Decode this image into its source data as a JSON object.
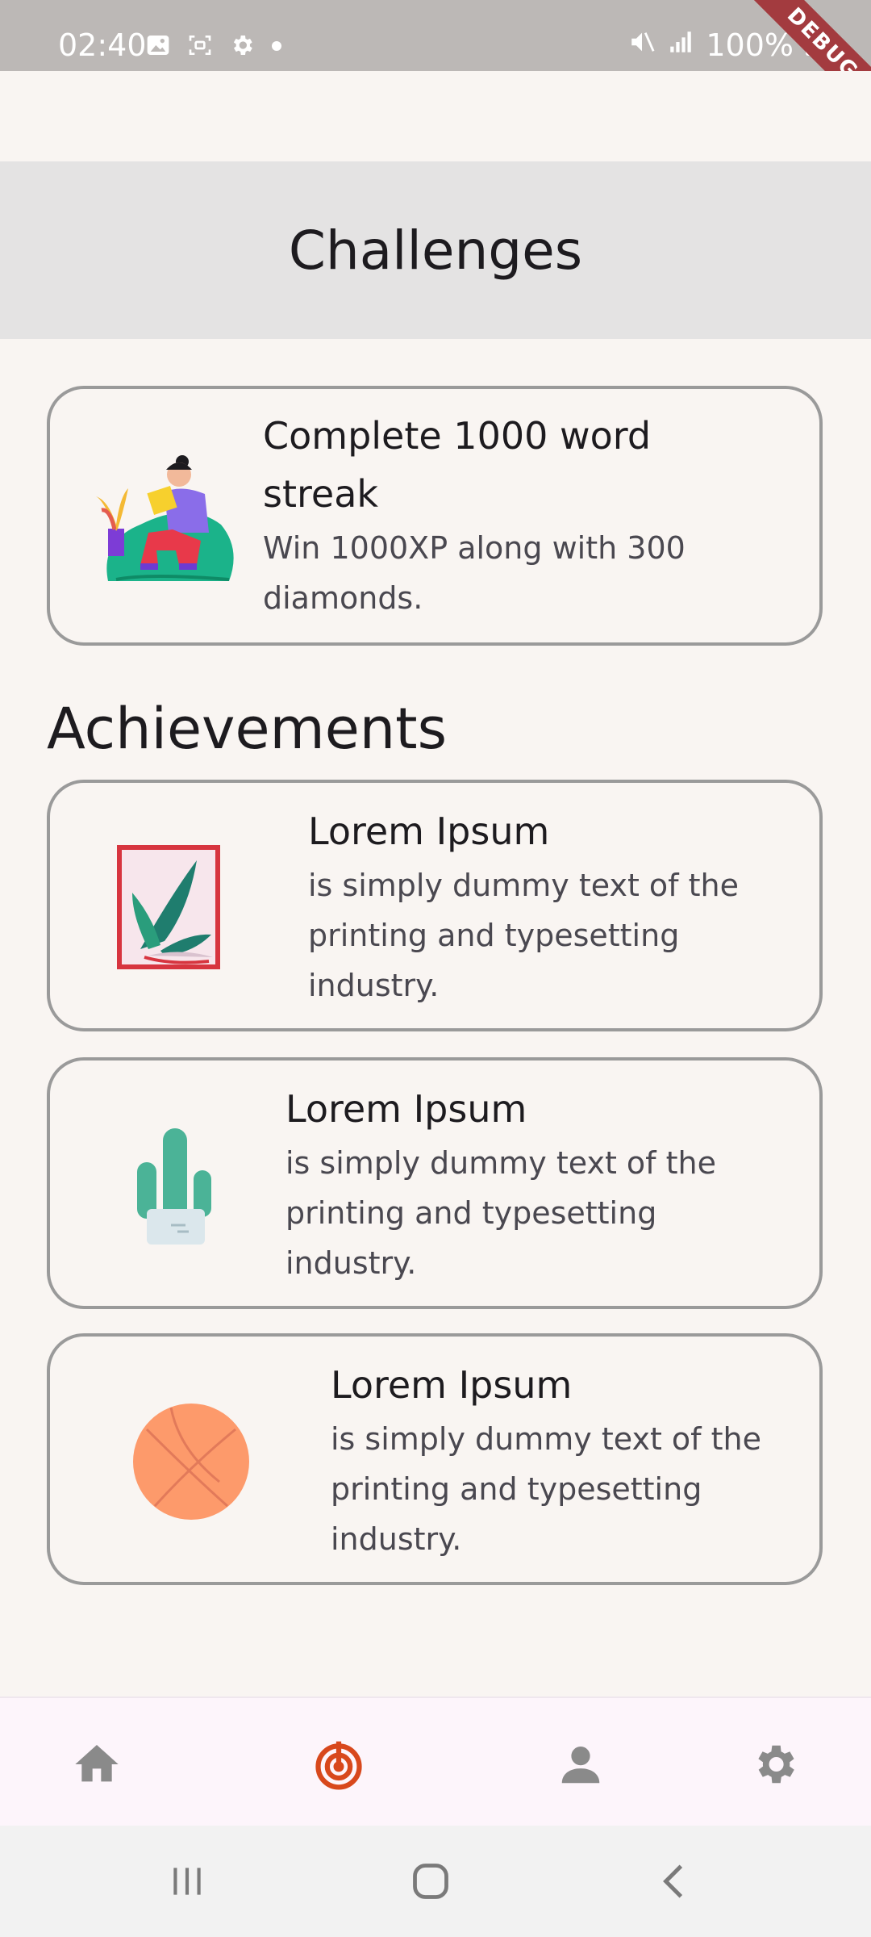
{
  "status_bar": {
    "time": "02:40",
    "battery": "100%",
    "debug_label": "DEBUG"
  },
  "appbar": {
    "title": "Challenges"
  },
  "challenge": {
    "title": "Complete 1000 word streak",
    "subtitle": "Win 1000XP along with 300 diamonds."
  },
  "achievements": {
    "heading": "Achievements",
    "items": [
      {
        "title": "Lorem Ipsum",
        "subtitle": "is simply dummy text of the printing and typesetting industry."
      },
      {
        "title": "Lorem Ipsum",
        "subtitle": "is simply dummy text of the printing and typesetting industry."
      },
      {
        "title": "Lorem Ipsum",
        "subtitle": "is simply dummy text of the printing and typesetting industry."
      }
    ]
  },
  "bottom_nav": {
    "active": "challenges",
    "items": [
      {
        "icon": "home-icon"
      },
      {
        "icon": "target-icon"
      },
      {
        "icon": "person-icon"
      },
      {
        "icon": "gear-icon"
      }
    ]
  },
  "colors": {
    "accent": "#d8481c",
    "inactive": "#8a8a8a",
    "card_border": "#9a9a9a",
    "background": "#f9f5f2"
  }
}
